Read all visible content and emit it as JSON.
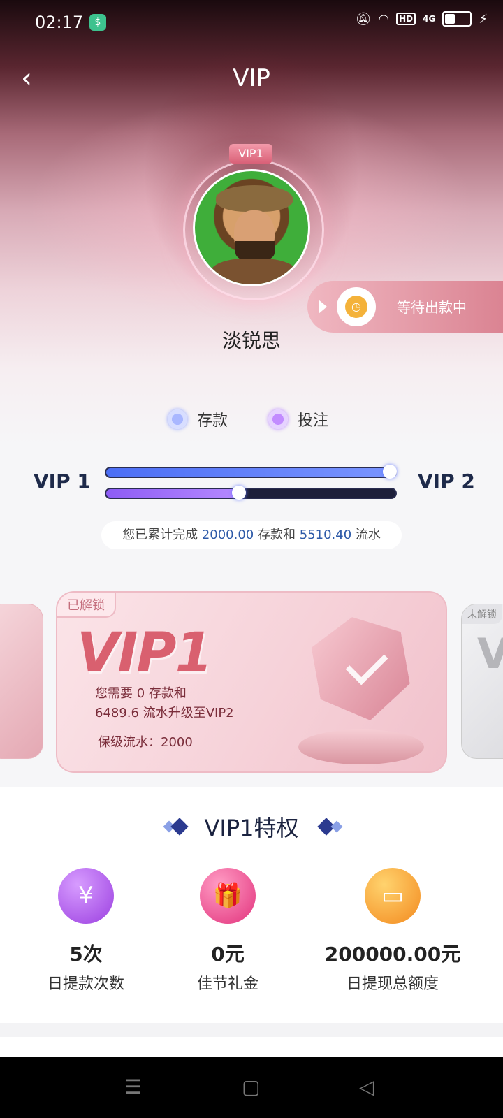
{
  "status_bar": {
    "time": "02:17",
    "network": "4G",
    "hd": "HD"
  },
  "header": {
    "title": "VIP"
  },
  "profile": {
    "vip_badge": "VIP1",
    "username": "淡锐思"
  },
  "payout": {
    "text": "等待出款中"
  },
  "legend": {
    "deposit": "存款",
    "wager": "投注"
  },
  "progress": {
    "current_level": "VIP 1",
    "next_level": "VIP 2",
    "deposit_progress": 1.0,
    "wager_progress": 0.46
  },
  "summary": {
    "prefix": "您已累计完成",
    "deposit_amount": "2000.00",
    "middle": "存款和",
    "wager_amount": "5510.40",
    "suffix": "流水"
  },
  "card": {
    "tag": "已解锁",
    "title": "VIP1",
    "line1": "您需要 0 存款和",
    "line2": "6489.6 流水升级至VIP2",
    "line3": "保级流水：2000"
  },
  "next_card": {
    "tag": "未解锁",
    "ghost": "V"
  },
  "privileges": {
    "title": "VIP1特权",
    "items": [
      {
        "value": "5次",
        "label": "日提款次数",
        "icon": "money-bag-icon",
        "glyph": "¥"
      },
      {
        "value": "0元",
        "label": "佳节礼金",
        "icon": "gift-icon",
        "glyph": "🎁"
      },
      {
        "value": "200000.00元",
        "label": "日提现总额度",
        "icon": "card-icon",
        "glyph": "▭"
      }
    ]
  },
  "nav": {
    "menu": "☰",
    "home": "▢",
    "back": "◁"
  },
  "colors": {
    "accent": "#2d5aa8",
    "deposit": "#4c6ef5",
    "wager": "#8d5cf5",
    "card_title": "#d9606f"
  }
}
